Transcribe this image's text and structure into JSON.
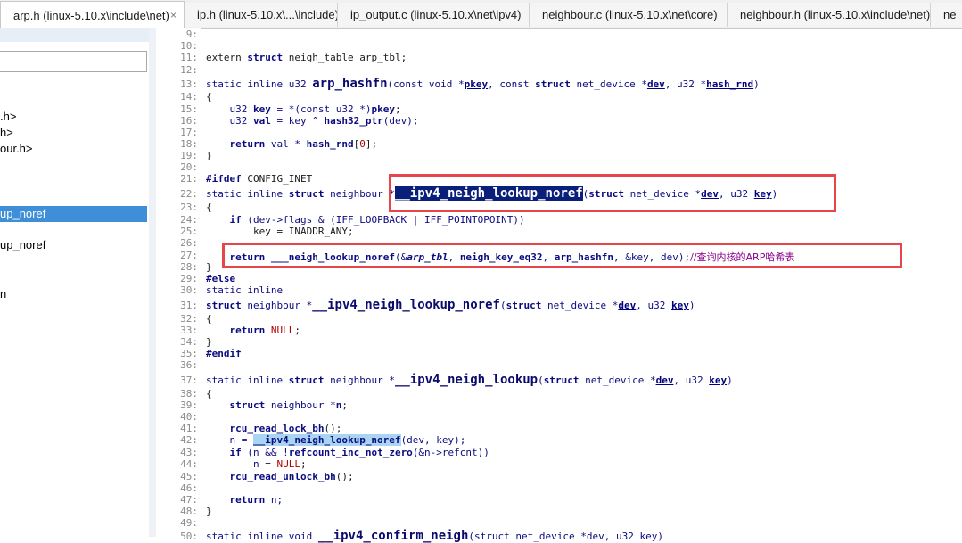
{
  "tabs": [
    {
      "label": "arp.h (linux-5.10.x\\include\\net)",
      "active": true
    },
    {
      "label": "ip.h (linux-5.10.x\\...\\include)"
    },
    {
      "label": "ip_output.c (linux-5.10.x\\net\\ipv4)"
    },
    {
      "label": "neighbour.c (linux-5.10.x\\net\\core)"
    },
    {
      "label": "neighbour.h (linux-5.10.x\\include\\net)"
    },
    {
      "label": "ne"
    }
  ],
  "close_glyph": "×",
  "sidebar": {
    "items": [
      {
        "label": ".h>"
      },
      {
        "label": "h>"
      },
      {
        "label": "our.h>"
      },
      {
        "label": "up_noref",
        "selected": true
      },
      {
        "label": "up_noref"
      },
      {
        "label": "n"
      }
    ]
  },
  "colors": {
    "highlight_box": "#e6454a",
    "selection": "#0a1f7a",
    "sidebar_selected": "#3f8fd8"
  },
  "code": {
    "line_numbers": [
      "9:",
      "10:",
      "11:",
      "12:",
      "13:",
      "14:",
      "15:",
      "16:",
      "17:",
      "18:",
      "19:",
      "20:",
      "21:",
      "22:",
      "23:",
      "24:",
      "25:",
      "26:",
      "27:",
      "28:",
      "29:",
      "30:",
      "31:",
      "32:",
      "33:",
      "34:",
      "35:",
      "36:",
      "37:",
      "38:",
      "39:",
      "40:",
      "41:",
      "42:",
      "43:",
      "44:",
      "45:",
      "46:",
      "47:",
      "48:",
      "49:",
      "50:"
    ],
    "l11": {
      "a": "extern",
      "b": "struct",
      "c": " neigh_table arp_tbl;"
    },
    "l13": {
      "a": "static inline u32 ",
      "fn": "arp_hashfn",
      "b": "(const void *",
      "p1": "pkey",
      "c": ", const ",
      "kw": "struct",
      "d": " net_device *",
      "p2": "dev",
      "e": ", u32 *",
      "p3": "hash_rnd",
      "f": ")"
    },
    "l14": "{",
    "l15": {
      "a": "    u32 ",
      "v": "key",
      "b": " = *(const u32 *)",
      "v2": "pkey",
      "c": ";"
    },
    "l16": {
      "a": "    u32 ",
      "v": "val",
      "b": " = key ^ ",
      "fn": "hash32_ptr",
      "c": "(dev);"
    },
    "l18": {
      "a": "    ",
      "kw": "return",
      "b": " val * ",
      "fn": "hash_rnd",
      "c": "[",
      "n": "0",
      "d": "];"
    },
    "l19": "}",
    "l21": {
      "kw": "#ifdef",
      "b": " CONFIG_INET"
    },
    "l22": {
      "a": "static inline ",
      "kw": "struct",
      "b": " neighbour *",
      "fn": "__ipv4_neigh_lookup_noref",
      "c": "(",
      "kw2": "struct",
      "d": " net_device *",
      "p1": "dev",
      "e": ", u32 ",
      "p2": "key",
      "f": ")"
    },
    "l23": "{",
    "l24": {
      "a": "    ",
      "kw": "if",
      "b": " (dev->flags & (IFF_LOOPBACK | IFF_POINTOPOINT))"
    },
    "l25": "        key = INADDR_ANY;",
    "l27": {
      "a": "    ",
      "kw": "return",
      "b": " ",
      "fn": "___neigh_lookup_noref",
      "c": "(&",
      "it": "arp_tbl",
      "d": ", ",
      "fn2": "neigh_key_eq32",
      "e": ", ",
      "fn3": "arp_hashfn",
      "f": ", &key, dev);",
      "cm": "//查询内核的ARP哈希表"
    },
    "l28": "}",
    "l29": "#else",
    "l30": "static inline",
    "l31": {
      "kw": "struct",
      "b": " neighbour *",
      "fn": "__ipv4_neigh_lookup_noref",
      "c": "(",
      "kw2": "struct",
      "d": " net_device *",
      "p1": "dev",
      "e": ", u32 ",
      "p2": "key",
      "f": ")"
    },
    "l32": "{",
    "l33": {
      "a": "    ",
      "kw": "return",
      "b": " ",
      "n": "NULL",
      "c": ";"
    },
    "l34": "}",
    "l35": "#endif",
    "l37": {
      "a": "static inline ",
      "kw": "struct",
      "b": " neighbour *",
      "fn": "__ipv4_neigh_lookup",
      "c": "(",
      "kw2": "struct",
      "d": " net_device *",
      "p1": "dev",
      "e": ", u32 ",
      "p2": "key",
      "f": ")"
    },
    "l38": "{",
    "l39": {
      "a": "    ",
      "kw": "struct",
      "b": " neighbour *",
      "v": "n",
      "c": ";"
    },
    "l41": {
      "a": "    ",
      "fn": "rcu_read_lock_bh",
      "b": "();"
    },
    "l42": {
      "a": "    n = ",
      "fn": "__ipv4_neigh_lookup_noref",
      "b": "(dev, key);"
    },
    "l43": {
      "a": "    ",
      "kw": "if",
      "b": " (n && !",
      "fn": "refcount_inc_not_zero",
      "c": "(&n->refcnt))"
    },
    "l44": {
      "a": "        n = ",
      "n": "NULL",
      "b": ";"
    },
    "l45": {
      "a": "    ",
      "fn": "rcu_read_unlock_bh",
      "b": "();"
    },
    "l47": {
      "a": "    ",
      "kw": "return",
      "b": " n;"
    },
    "l48": "}",
    "l50": {
      "a": "static inline void ",
      "fn": "__ipv4_confirm_neigh",
      "b": "(struct net_device *dev, u32 key)"
    }
  }
}
